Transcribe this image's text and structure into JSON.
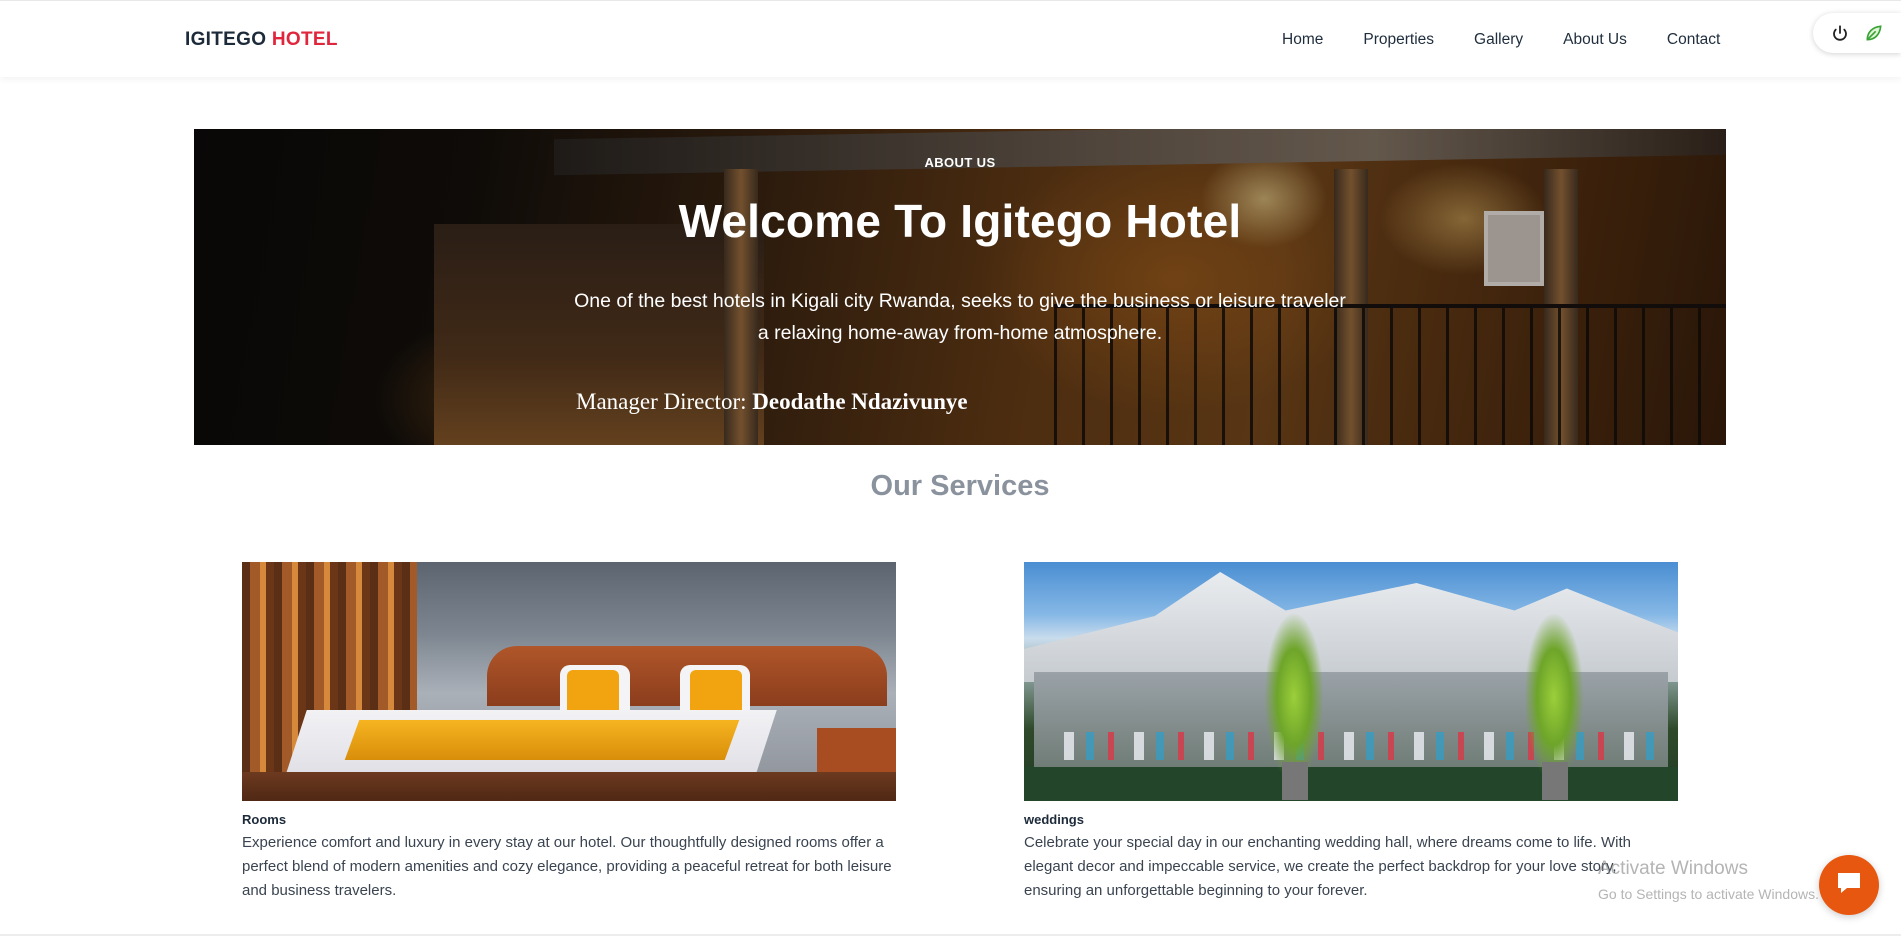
{
  "brand": {
    "name": "IGITEGO",
    "accent": "HOTEL",
    "accent_color": "#e0263c"
  },
  "nav": {
    "items": [
      "Home",
      "Properties",
      "Gallery",
      "About Us",
      "Contact"
    ]
  },
  "widget": {
    "icons": [
      "power-icon",
      "leaf-icon"
    ]
  },
  "hero": {
    "kicker": "ABOUT US",
    "title": "Welcome To Igitego Hotel",
    "lead": "One of the best hotels in Kigali city Rwanda, seeks to give the business or leisure traveler a relaxing home-away from-home atmosphere.",
    "director_label": "Manager Director:",
    "director_name": "Deodathe Ndazivunye"
  },
  "services": {
    "title": "Our Services",
    "cards": [
      {
        "title": "Rooms",
        "description": "Experience comfort and luxury in every stay at our hotel. Our thoughtfully designed rooms offer a perfect blend of modern amenities and cozy elegance, providing a peaceful retreat for both leisure and business travelers."
      },
      {
        "title": "weddings",
        "description": "Celebrate your special day in our enchanting wedding hall, where dreams come to life. With elegant decor and impeccable service, we create the perfect backdrop for your love story, ensuring an unforgettable beginning to your forever."
      }
    ]
  },
  "watermark": {
    "line1": "Activate Windows",
    "line2": "Go to Settings to activate Windows."
  },
  "chat": {
    "icon": "chat-bubble-icon",
    "color": "#e8570f"
  }
}
